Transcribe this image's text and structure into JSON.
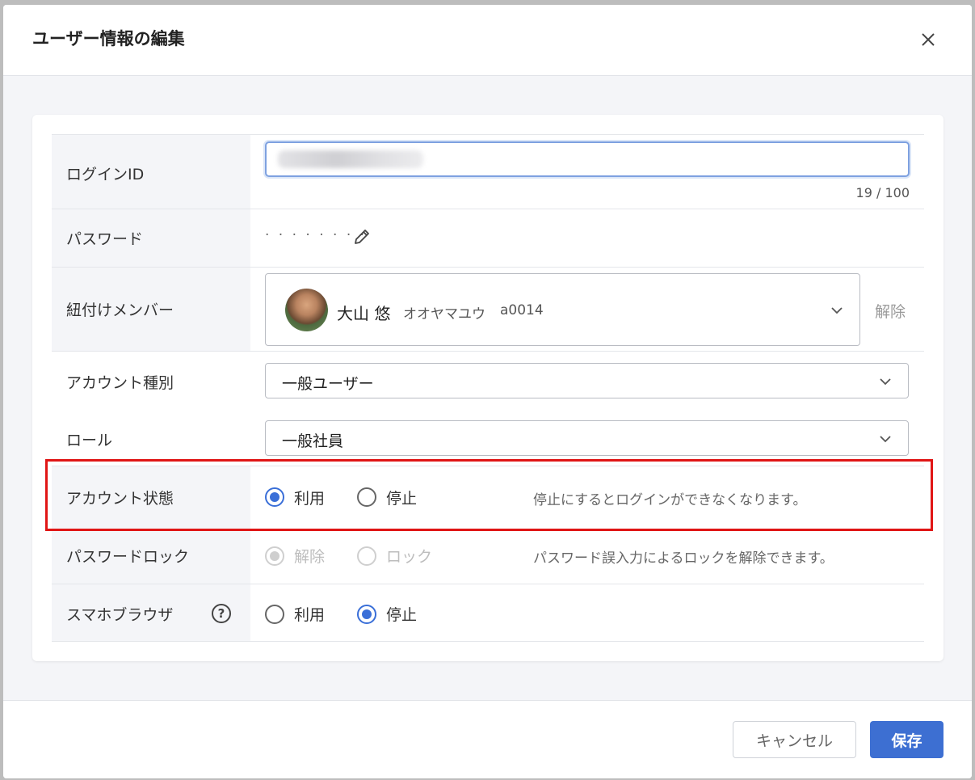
{
  "dialog": {
    "title": "ユーザー情報の編集"
  },
  "fields": {
    "login_id": {
      "label": "ログインID",
      "counter": "19 / 100"
    },
    "password": {
      "label": "パスワード",
      "masked": "· · · · · · · ·"
    },
    "member": {
      "label": "紐付けメンバー",
      "name": "大山 悠",
      "kana": "オオヤマユウ",
      "code": "a0014",
      "unlink": "解除"
    },
    "account_type": {
      "label": "アカウント種別",
      "value": "一般ユーザー"
    },
    "role": {
      "label": "ロール",
      "value": "一般社員"
    },
    "account_status": {
      "label": "アカウント状態",
      "options": [
        "利用",
        "停止"
      ],
      "selected": "利用",
      "hint": "停止にするとログインができなくなります。"
    },
    "password_lock": {
      "label": "パスワードロック",
      "options": [
        "解除",
        "ロック"
      ],
      "selected": "解除",
      "disabled": true,
      "hint": "パスワード誤入力によるロックを解除できます。"
    },
    "mobile_browser": {
      "label": "スマホブラウザ",
      "help": "?",
      "options": [
        "利用",
        "停止"
      ],
      "selected": "停止"
    }
  },
  "footer": {
    "cancel": "キャンセル",
    "save": "保存"
  },
  "colors": {
    "accent": "#3a6fd8",
    "highlight": "#e01515"
  }
}
